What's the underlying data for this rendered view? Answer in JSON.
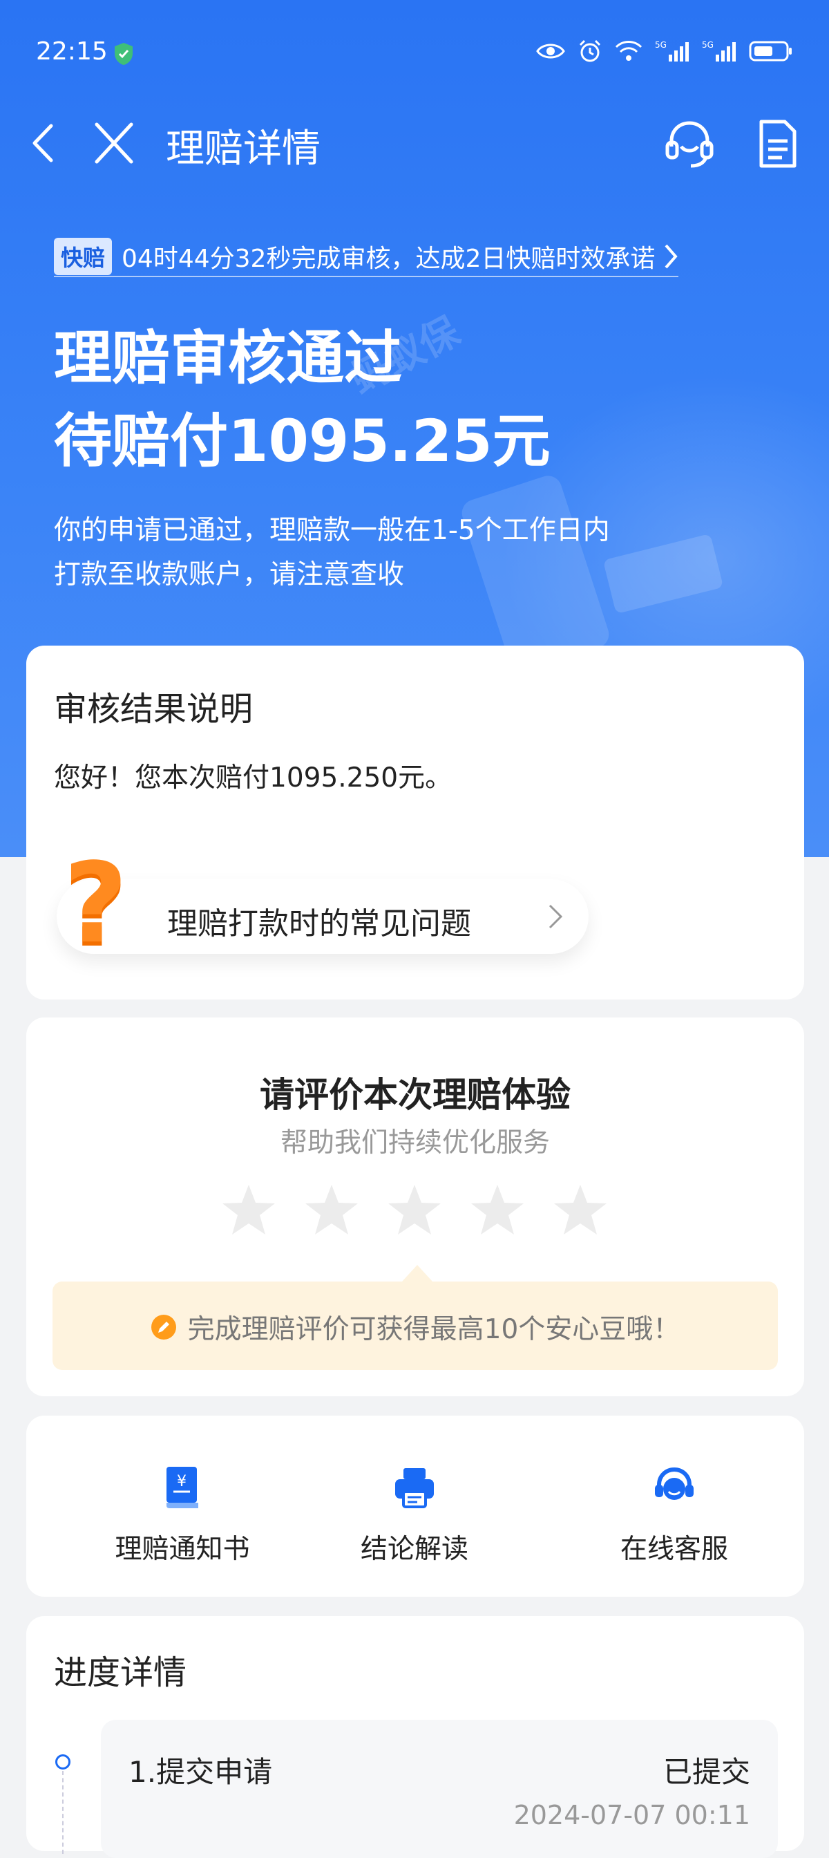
{
  "status_bar": {
    "time": "22:15"
  },
  "topbar": {
    "title": "理赔详情"
  },
  "fast_claim": {
    "badge": "快赔",
    "text": "04时44分32秒完成审核，达成2日快赔时效承诺"
  },
  "hero": {
    "title_line1": "理赔审核通过",
    "title_line2": "待赔付1095.25元",
    "desc": "你的申请已通过，理赔款一般在1-5个工作日内打款至收款账户，请注意查收",
    "watermark": "蚂蚁保"
  },
  "review_card": {
    "heading": "审核结果说明",
    "body": "您好！您本次赔付1095.250元。",
    "faq_label": "理赔打款时的常见问题"
  },
  "rating_card": {
    "heading": "请评价本次理赔体验",
    "subtitle": "帮助我们持续优化服务",
    "rating": 0,
    "max_rating": 5,
    "tip": "完成理赔评价可获得最高10个安心豆哦！"
  },
  "actions": [
    {
      "label": "理赔通知书",
      "icon": "notice-book-icon"
    },
    {
      "label": "结论解读",
      "icon": "printer-icon"
    },
    {
      "label": "在线客服",
      "icon": "headset-icon"
    }
  ],
  "progress": {
    "heading": "进度详情",
    "steps": [
      {
        "title": "1.提交申请",
        "status": "已提交",
        "time": "2024-07-07 00:11"
      }
    ]
  },
  "colors": {
    "brand_blue": "#2a74f3",
    "tip_bg": "#fef3de",
    "accent_orange": "#ff8a1f"
  }
}
